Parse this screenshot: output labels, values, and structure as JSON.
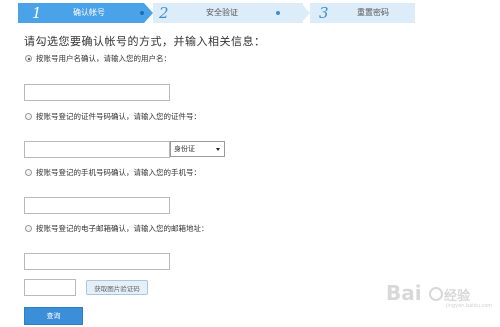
{
  "steps": [
    {
      "num": "1",
      "label": "确认帐号",
      "active": true
    },
    {
      "num": "2",
      "label": "安全验证",
      "active": false
    },
    {
      "num": "3",
      "label": "重置密码",
      "active": false
    }
  ],
  "heading": "请勾选您要确认帐号的方式，并输入相关信息：",
  "options": {
    "username": {
      "label": "按账号用户名确认，请输入您的用户名：",
      "checked": true,
      "value": ""
    },
    "id_number": {
      "label": "按账号登记的证件号码确认，请输入您的证件号：",
      "checked": false,
      "value": ""
    },
    "phone": {
      "label": "按账号登记的手机号码确认，请输入您的手机号：",
      "checked": false,
      "value": ""
    },
    "email": {
      "label": "按账号登记的电子邮箱确认，请输入您的邮箱地址：",
      "checked": false,
      "value": ""
    }
  },
  "id_type_select": {
    "selected": "身份证"
  },
  "captcha": {
    "value": "",
    "button_label": "获取图片验证码"
  },
  "submit_label": "查询",
  "watermark": {
    "text": "Bai",
    "suffix": "经验",
    "url": "jingyan.baidu.com"
  },
  "colors": {
    "accent": "#3b8fd9",
    "step_active": "#4aa3e8",
    "step_inactive": "#dcedf9"
  }
}
